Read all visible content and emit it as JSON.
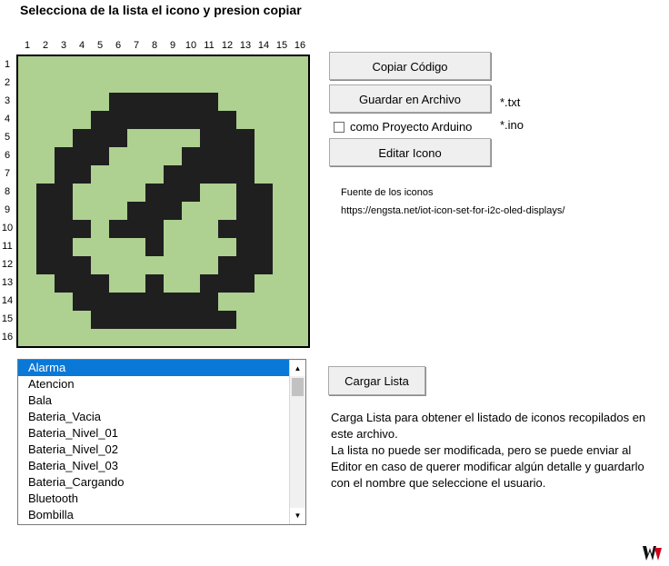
{
  "title": "Selecciona de la lista el icono y presion copiar",
  "columns": [
    "1",
    "2",
    "3",
    "4",
    "5",
    "6",
    "7",
    "8",
    "9",
    "10",
    "11",
    "12",
    "13",
    "14",
    "15",
    "16"
  ],
  "rows": [
    "1",
    "2",
    "3",
    "4",
    "5",
    "6",
    "7",
    "8",
    "9",
    "10",
    "11",
    "12",
    "13",
    "14",
    "15",
    "16"
  ],
  "icon_pixels": [
    "................",
    "................",
    ".....111111.....",
    "....11111111....",
    "...111....111...",
    "..111....1111...",
    "..11....11111...",
    ".11....111..11..",
    ".11...111...11..",
    ".111.111...111..",
    ".11....1....11..",
    ".111.......111..",
    "..111..1..111...",
    "...11111111.....",
    "....11111111....",
    "................"
  ],
  "buttons": {
    "copy": "Copiar Código",
    "save": "Guardar en Archivo",
    "edit": "Editar Icono",
    "load": "Cargar Lista"
  },
  "ext_txt": "*.txt",
  "ext_ino": "*.ino",
  "checkbox_label": "como Proyecto Arduino",
  "checkbox_checked": false,
  "source": {
    "label": "Fuente de los iconos",
    "url": "https://engsta.net/iot-icon-set-for-i2c-oled-displays/"
  },
  "list": {
    "items": [
      "Alarma",
      "Atencion",
      "Bala",
      "Bateria_Vacia",
      "Bateria_Nivel_01",
      "Bateria_Nivel_02",
      "Bateria_Nivel_03",
      "Bateria_Cargando",
      "Bluetooth",
      "Bombilla"
    ],
    "selected": "Alarma"
  },
  "description": [
    "Carga Lista para obtener el listado de iconos recopilados en este archivo.",
    "La lista no puede ser modificada, pero se puede enviar al Editor en caso de querer modificar algún detalle y guardarlo con el nombre que seleccione el usuario."
  ],
  "colors": {
    "grid_bg": "#aed091",
    "pixel_on": "#1f1f1f",
    "selection": "#0a78d7"
  }
}
